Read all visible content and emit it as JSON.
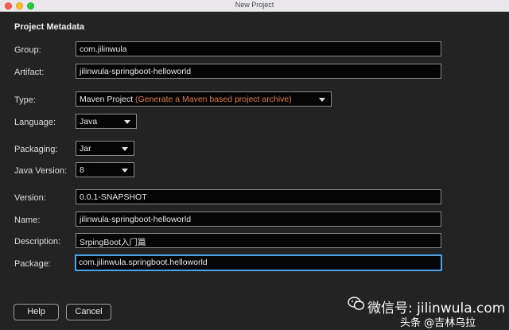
{
  "window": {
    "title": "New Project"
  },
  "section_title": "Project Metadata",
  "fields": {
    "group": {
      "label": "Group:",
      "value": "com.jilinwula"
    },
    "artifact": {
      "label": "Artifact:",
      "value": "jilinwula-springboot-helloworld"
    },
    "type": {
      "label": "Type:",
      "value": "Maven Project",
      "hint": "(Generate a Maven based project archive)"
    },
    "language": {
      "label": "Language:",
      "value": "Java"
    },
    "packaging": {
      "label": "Packaging:",
      "value": "Jar"
    },
    "java_version": {
      "label": "Java Version:",
      "value": "8"
    },
    "version": {
      "label": "Version:",
      "value": "0.0.1-SNAPSHOT"
    },
    "name": {
      "label": "Name:",
      "value": "jilinwula-springboot-helloworld"
    },
    "description": {
      "label": "Description:",
      "value": "SrpingBoot入门篇"
    },
    "package": {
      "label": "Package:",
      "value": "com.jilinwula.springboot.helloworld"
    }
  },
  "buttons": {
    "help": "Help",
    "cancel": "Cancel"
  },
  "watermark": {
    "line1": "微信号: jilinwula.com",
    "line2": "头条 @吉林乌拉"
  },
  "colors": {
    "hint": "#e37a3f",
    "focus": "#4aa2e8",
    "background": "#232323"
  }
}
